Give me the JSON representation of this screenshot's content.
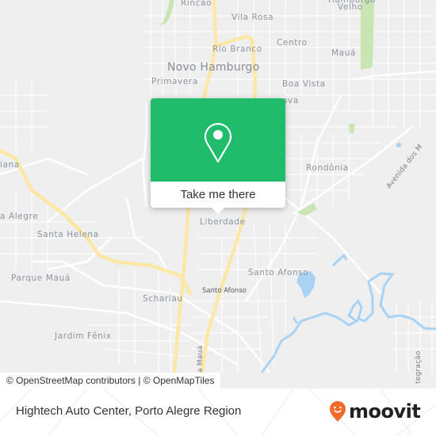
{
  "map": {
    "labels": {
      "rincao": "Rincão",
      "vila_rosa": "Vila Rosa",
      "hamburgo_velho_1": "Hamburgo",
      "hamburgo_velho_2": "Velho",
      "centro": "Centro",
      "rio_branco": "Rio Branco",
      "maua": "Mauá",
      "novo_hamburgo": "Novo Hamburgo",
      "primavera": "Primavera",
      "boa_vista": "Boa Vista",
      "nova": "ova",
      "rondonia": "Rondônia",
      "avenida_dos": "Avenida dos M",
      "iana": "iana",
      "alegre": "a Alegre",
      "santa_helena": "Santa Helena",
      "liberdade": "Liberdade",
      "parque_maua": "Parque Mauá",
      "santo_afonso_district": "Santo Afonso",
      "santo_afonso_poi": "Santo Afonso",
      "scharlau": "Scharlau",
      "jardim_fenix": "Jardim Fênix",
      "av_maua": "a Mauá",
      "integracao": "tegração"
    },
    "colors": {
      "background": "#efefef",
      "major_road": "#fbe8a6",
      "park": "#c9e6b2",
      "water": "#a9d3f5",
      "popup_green": "#20bb6b"
    }
  },
  "popup": {
    "icon": "location-pin-icon",
    "cta_label": "Take me there"
  },
  "attribution": "© OpenStreetMap contributors | © OpenMapTiles",
  "footer": {
    "place_title": "Hightech Auto Center, Porto Alegre Region",
    "brand": "moovit",
    "brand_color": "#f26b2a"
  }
}
